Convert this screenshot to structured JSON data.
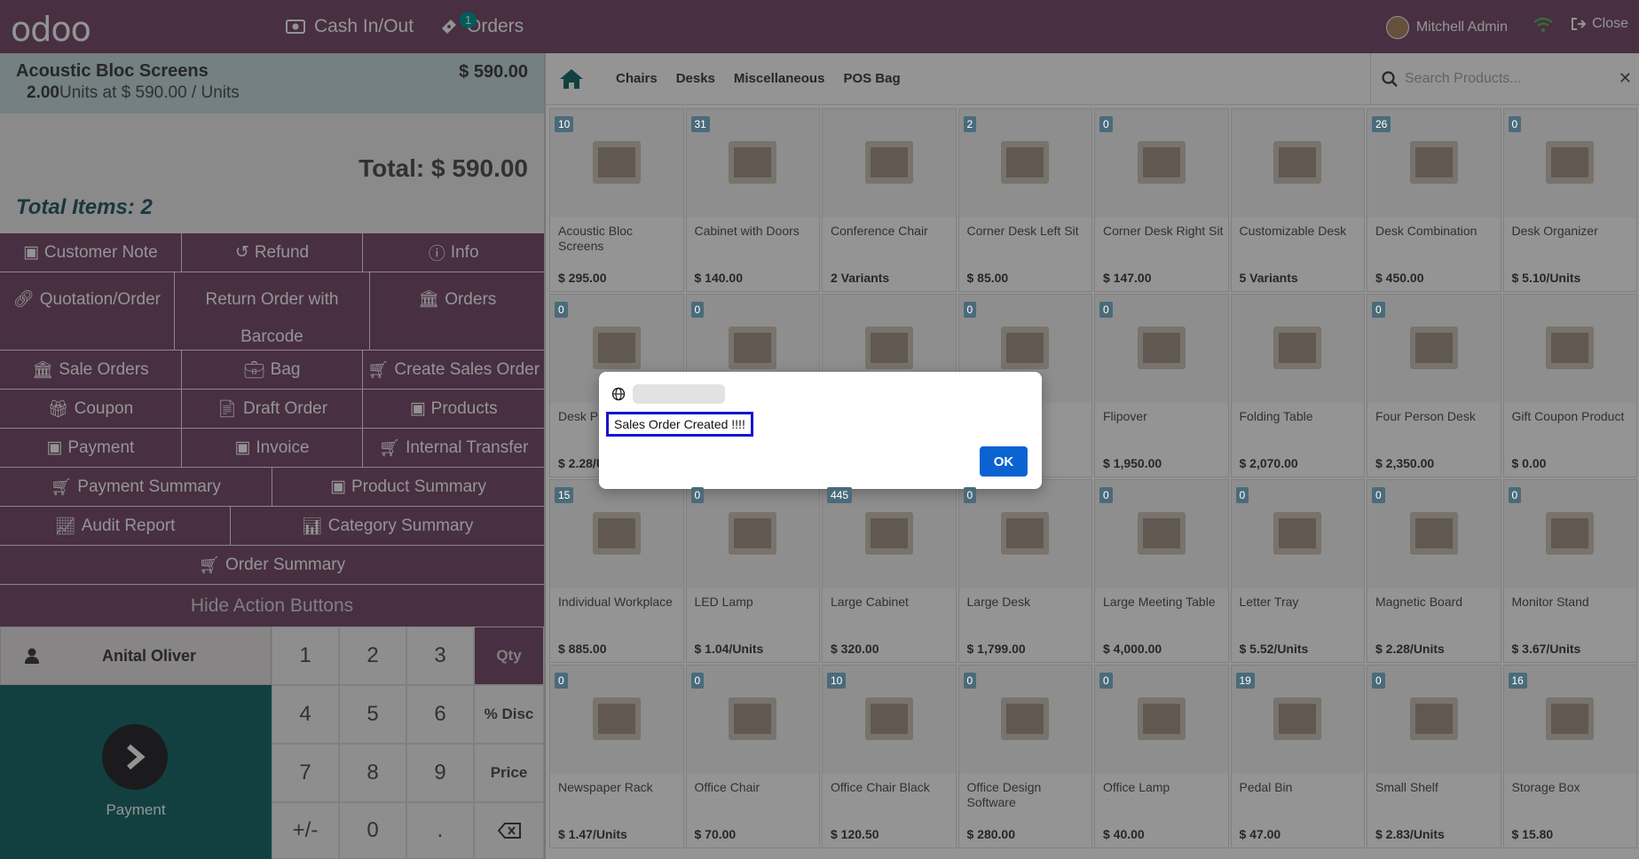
{
  "topbar": {
    "logo": "odoo",
    "cash_label": "Cash In/Out",
    "orders_label": "Orders",
    "orders_badge": "1",
    "user_name": "Mitchell Admin",
    "close_label": "Close"
  },
  "order": {
    "line_name": "Acoustic Bloc Screens",
    "line_price": "$ 590.00",
    "line_qty": "2.00",
    "line_unit": "Units at $ 590.00 / Units",
    "total": "Total: $ 590.00",
    "total_items": "Total Items: 2"
  },
  "actions": {
    "customer_note": "Customer Note",
    "refund": "Refund",
    "info": "Info",
    "quotation": "Quotation/Order",
    "return_order": "Return Order with Barcode",
    "orders": "Orders",
    "sale_orders": "Sale Orders",
    "bag": "Bag",
    "create_sales_order": "Create Sales Order",
    "coupon": "Coupon",
    "draft_order": "Draft Order",
    "products": "Products",
    "payment": "Payment",
    "invoice": "Invoice",
    "internal_transfer": "Internal Transfer",
    "payment_summary": "Payment Summary",
    "product_summary": "Product Summary",
    "audit_report": "Audit Report",
    "category_summary": "Category Summary",
    "order_summary": "Order Summary",
    "hide_action_buttons": "Hide Action Buttons"
  },
  "customer": {
    "name": "Anital Oliver"
  },
  "pay": {
    "label": "Payment"
  },
  "numpad": {
    "k1": "1",
    "k2": "2",
    "k3": "3",
    "qty": "Qty",
    "k4": "4",
    "k5": "5",
    "k6": "6",
    "disc": "% Disc",
    "k7": "7",
    "k8": "8",
    "k9": "9",
    "price": "Price",
    "pm": "+/-",
    "k0": "0",
    "dot": "."
  },
  "categories": {
    "c1": "Chairs",
    "c2": "Desks",
    "c3": "Miscellaneous",
    "c4": "POS Bag",
    "search_placeholder": "Search Products..."
  },
  "products": [
    {
      "name": "Acoustic Bloc Screens",
      "price": "$ 295.00",
      "count": "10"
    },
    {
      "name": "Cabinet with Doors",
      "price": "$ 140.00",
      "count": "31"
    },
    {
      "name": "Conference Chair",
      "price": "2 Variants",
      "count": ""
    },
    {
      "name": "Corner Desk Left Sit",
      "price": "$ 85.00",
      "count": "2"
    },
    {
      "name": "Corner Desk Right Sit",
      "price": "$ 147.00",
      "count": "0"
    },
    {
      "name": "Customizable Desk",
      "price": "5 Variants",
      "count": ""
    },
    {
      "name": "Desk Combination",
      "price": "$ 450.00",
      "count": "26"
    },
    {
      "name": "Desk Organizer",
      "price": "$ 5.10/Units",
      "count": "0"
    },
    {
      "name": "Desk Pad",
      "price": "$ 2.28/Units",
      "count": "0"
    },
    {
      "name": "",
      "price": "",
      "count": "0"
    },
    {
      "name": "",
      "price": "",
      "count": ""
    },
    {
      "name": "",
      "price": "",
      "count": "0"
    },
    {
      "name": "Flipover",
      "price": "$ 1,950.00",
      "count": "0"
    },
    {
      "name": "Folding Table",
      "price": "$ 2,070.00",
      "count": ""
    },
    {
      "name": "Four Person Desk",
      "price": "$ 2,350.00",
      "count": "0"
    },
    {
      "name": "Gift Coupon Product",
      "price": "$ 0.00",
      "count": ""
    },
    {
      "name": "Individual Workplace",
      "price": "$ 885.00",
      "count": "15"
    },
    {
      "name": "LED Lamp",
      "price": "$ 1.04/Units",
      "count": "0"
    },
    {
      "name": "Large Cabinet",
      "price": "$ 320.00",
      "count": "445"
    },
    {
      "name": "Large Desk",
      "price": "$ 1,799.00",
      "count": "0"
    },
    {
      "name": "Large Meeting Table",
      "price": "$ 4,000.00",
      "count": "0"
    },
    {
      "name": "Letter Tray",
      "price": "$ 5.52/Units",
      "count": "0"
    },
    {
      "name": "Magnetic Board",
      "price": "$ 2.28/Units",
      "count": "0"
    },
    {
      "name": "Monitor Stand",
      "price": "$ 3.67/Units",
      "count": "0"
    },
    {
      "name": "Newspaper Rack",
      "price": "$ 1.47/Units",
      "count": "0"
    },
    {
      "name": "Office Chair",
      "price": "$ 70.00",
      "count": "0"
    },
    {
      "name": "Office Chair Black",
      "price": "$ 120.50",
      "count": "10"
    },
    {
      "name": "Office Design Software",
      "price": "$ 280.00",
      "count": "0"
    },
    {
      "name": "Office Lamp",
      "price": "$ 40.00",
      "count": "0"
    },
    {
      "name": "Pedal Bin",
      "price": "$ 47.00",
      "count": "19"
    },
    {
      "name": "Small Shelf",
      "price": "$ 2.83/Units",
      "count": "0"
    },
    {
      "name": "Storage Box",
      "price": "$ 15.80",
      "count": "16"
    }
  ],
  "dialog": {
    "message": "Sales Order Created !!!!",
    "ok_label": "OK"
  },
  "colors": {
    "brand": "#7c5272",
    "teal": "#206e6e",
    "ok_button": "#0b63d1"
  }
}
